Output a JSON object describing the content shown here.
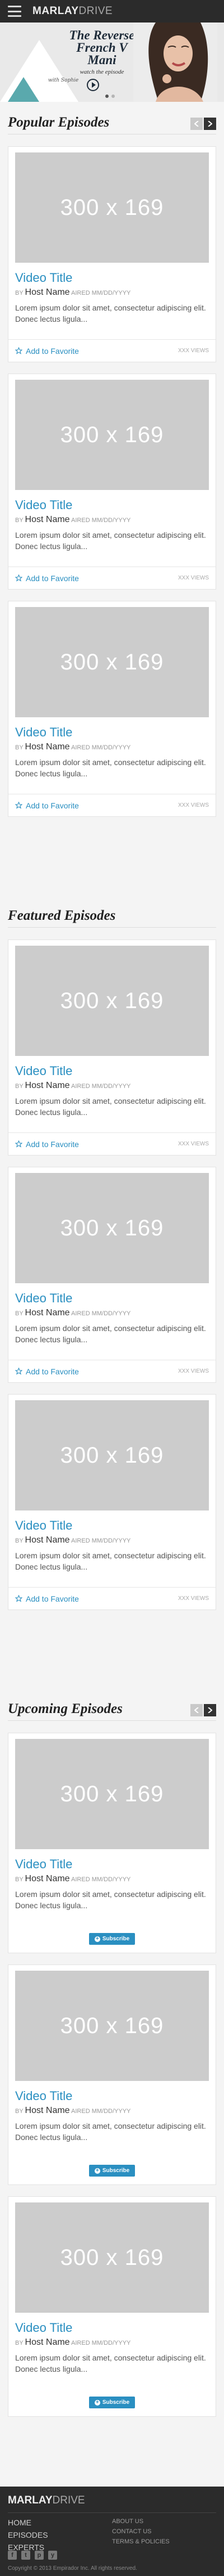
{
  "header": {
    "logo_bold": "MARLAY",
    "logo_light": "DRIVE"
  },
  "hero": {
    "title": "The Reverse French V Mani",
    "subtitle": "watch the episode",
    "signature": "with Sophie"
  },
  "sections": [
    {
      "title": "Popular Episodes",
      "cards": [
        {
          "thumb": "300 x 169",
          "title": "Video Title",
          "by": "BY",
          "host": "Host Name",
          "aired": "AIRED MM/DD/YYYY",
          "desc": "Lorem ipsum dolor sit amet, consectetur adipiscing elit. Donec lectus ligula...",
          "fav": "Add to Favorite",
          "views": "XXX VIEWS"
        },
        {
          "thumb": "300 x 169",
          "title": "Video Title",
          "by": "BY",
          "host": "Host Name",
          "aired": "AIRED MM/DD/YYYY",
          "desc": "Lorem ipsum dolor sit amet, consectetur adipiscing elit. Donec lectus ligula...",
          "fav": "Add to Favorite",
          "views": "XXX VIEWS"
        },
        {
          "thumb": "300 x 169",
          "title": "Video Title",
          "by": "BY",
          "host": "Host Name",
          "aired": "AIRED MM/DD/YYYY",
          "desc": "Lorem ipsum dolor sit amet, consectetur adipiscing elit. Donec lectus ligula...",
          "fav": "Add to Favorite",
          "views": "XXX VIEWS"
        }
      ]
    },
    {
      "title": "Featured Episodes",
      "cards": [
        {
          "thumb": "300 x 169",
          "title": "Video Title",
          "by": "BY",
          "host": "Host Name",
          "aired": "AIRED MM/DD/YYYY",
          "desc": "Lorem ipsum dolor sit amet, consectetur adipiscing elit. Donec lectus ligula...",
          "fav": "Add to Favorite",
          "views": "XXX VIEWS"
        },
        {
          "thumb": "300 x 169",
          "title": "Video Title",
          "by": "BY",
          "host": "Host Name",
          "aired": "AIRED MM/DD/YYYY",
          "desc": "Lorem ipsum dolor sit amet, consectetur adipiscing elit. Donec lectus ligula...",
          "fav": "Add to Favorite",
          "views": "XXX VIEWS"
        },
        {
          "thumb": "300 x 169",
          "title": "Video Title",
          "by": "BY",
          "host": "Host Name",
          "aired": "AIRED MM/DD/YYYY",
          "desc": "Lorem ipsum dolor sit amet, consectetur adipiscing elit. Donec lectus ligula...",
          "fav": "Add to Favorite",
          "views": "XXX VIEWS"
        }
      ]
    },
    {
      "title": "Upcoming Episodes",
      "cards": [
        {
          "thumb": "300 x 169",
          "title": "Video Title",
          "by": "BY",
          "host": "Host Name",
          "aired": "AIRED MM/DD/YYYY",
          "desc": "Lorem ipsum dolor sit amet, consectetur adipiscing elit. Donec lectus ligula...",
          "subscribe": "Subscribe"
        },
        {
          "thumb": "300 x 169",
          "title": "Video Title",
          "by": "BY",
          "host": "Host Name",
          "aired": "AIRED MM/DD/YYYY",
          "desc": "Lorem ipsum dolor sit amet, consectetur adipiscing elit. Donec lectus ligula...",
          "subscribe": "Subscribe"
        },
        {
          "thumb": "300 x 169",
          "title": "Video Title",
          "by": "BY",
          "host": "Host Name",
          "aired": "AIRED MM/DD/YYYY",
          "desc": "Lorem ipsum dolor sit amet, consectetur adipiscing elit. Donec lectus ligula...",
          "subscribe": "Subscribe"
        }
      ]
    }
  ],
  "footer": {
    "logo_bold": "MARLAY",
    "logo_light": "DRIVE",
    "nav": [
      "HOME",
      "EPISODES",
      "EXPERTS"
    ],
    "links": [
      "ABOUT US",
      "CONTACT US",
      "TERMS & POLICIES"
    ],
    "social": [
      "f",
      "t",
      "p",
      "y"
    ],
    "copyright": "Copyright © 2013 Empirador Inc. All rights reserved."
  },
  "colors": {
    "accent": "#2a8fc1",
    "header_bg": "#2b2b2b",
    "placeholder": "#cccccc"
  }
}
